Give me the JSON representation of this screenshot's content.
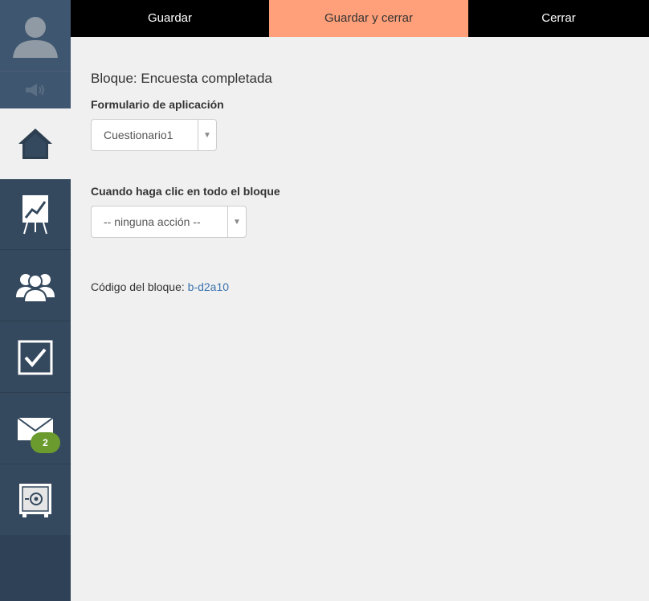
{
  "topbar": {
    "save_label": "Guardar",
    "save_close_label": "Guardar y cerrar",
    "close_label": "Cerrar"
  },
  "sidebar": {
    "items": [
      {
        "icon": "user-avatar-icon"
      },
      {
        "icon": "speaker-icon"
      },
      {
        "icon": "home-icon",
        "active": true
      },
      {
        "icon": "chart-board-icon"
      },
      {
        "icon": "users-group-icon"
      },
      {
        "icon": "checkbox-icon"
      },
      {
        "icon": "mail-icon",
        "badge": "2"
      },
      {
        "icon": "safe-icon"
      }
    ]
  },
  "main": {
    "block_title": "Bloque: Encuesta completada",
    "form_label": "Formulario de aplicación",
    "form_select_value": "Cuestionario1",
    "click_label": "Cuando haga clic en todo el bloque",
    "click_select_value": "-- ninguna acción --",
    "code_label": "Código del bloque:",
    "code_value": "b-d2a10"
  },
  "colors": {
    "sidebar": "#34495e",
    "accent_button": "#ffa07a",
    "badge": "#6b9b2e",
    "link": "#3b73b0"
  }
}
